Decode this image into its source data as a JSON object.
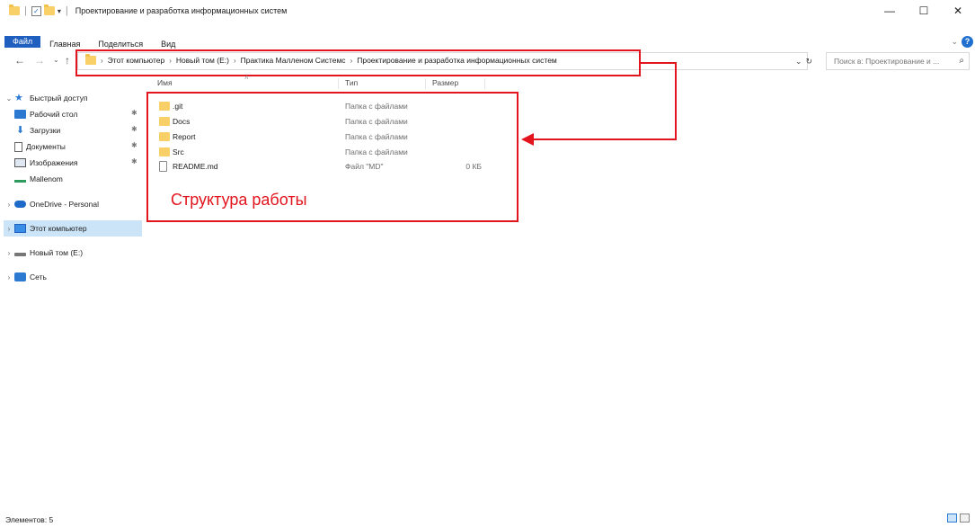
{
  "window": {
    "title": "Проектирование и разработка информационных систем",
    "controls": {
      "minimize": "—",
      "maximize": "☐",
      "close": "✕"
    }
  },
  "ribbon": {
    "tabs": [
      "Файл",
      "Главная",
      "Поделиться",
      "Вид"
    ],
    "expand": "⌄",
    "help": "?"
  },
  "address": {
    "breadcrumbs": [
      "Этот компьютер",
      "Новый том (E:)",
      "Практика Малленом Системс",
      "Проектирование и разработка информационных систем"
    ],
    "separator": "›",
    "dropdown": "⌄",
    "refresh": "↻",
    "search_placeholder": "Поиск в: Проектирование и ..."
  },
  "nav": {
    "back": "←",
    "forward": "→",
    "recent": "⌄",
    "up": "↑"
  },
  "sidebar": {
    "items": [
      {
        "label": "Быстрый доступ",
        "icon": "star-icon",
        "expander": "⌄"
      },
      {
        "label": "Рабочий стол",
        "icon": "desktop-icon",
        "pinned": "✱"
      },
      {
        "label": "Загрузки",
        "icon": "download-icon",
        "pinned": "✱"
      },
      {
        "label": "Документы",
        "icon": "document-icon",
        "pinned": "✱"
      },
      {
        "label": "Изображения",
        "icon": "pictures-icon",
        "pinned": "✱"
      },
      {
        "label": "Mallenom",
        "icon": "folder-icon"
      },
      {
        "label": "OneDrive - Personal",
        "icon": "cloud-icon",
        "expander": "›"
      },
      {
        "label": "Этот компьютер",
        "icon": "computer-icon",
        "expander": "›",
        "selected": true
      },
      {
        "label": "Новый том (E:)",
        "icon": "drive-icon",
        "expander": "›"
      },
      {
        "label": "Сеть",
        "icon": "network-icon",
        "expander": "›"
      }
    ]
  },
  "columns": {
    "name": "Имя",
    "type": "Тип",
    "size": "Размер",
    "sort": "˄"
  },
  "files": [
    {
      "name": ".git",
      "type": "Папка с файлами",
      "size": "",
      "kind": "folder"
    },
    {
      "name": "Docs",
      "type": "Папка с файлами",
      "size": "",
      "kind": "folder"
    },
    {
      "name": "Report",
      "type": "Папка с файлами",
      "size": "",
      "kind": "folder"
    },
    {
      "name": "Src",
      "type": "Папка с файлами",
      "size": "",
      "kind": "folder"
    },
    {
      "name": "README.md",
      "type": "Файл \"MD\"",
      "size": "0 КБ",
      "kind": "file"
    }
  ],
  "annotation": {
    "text": "Структура работы",
    "color": "#e2141e"
  },
  "status": {
    "items_count": "Элементов: 5"
  },
  "colors": {
    "accent": "#1f5fbf",
    "selection": "#cce4f7",
    "folder": "#f8d067",
    "annotation": "#e2141e"
  }
}
